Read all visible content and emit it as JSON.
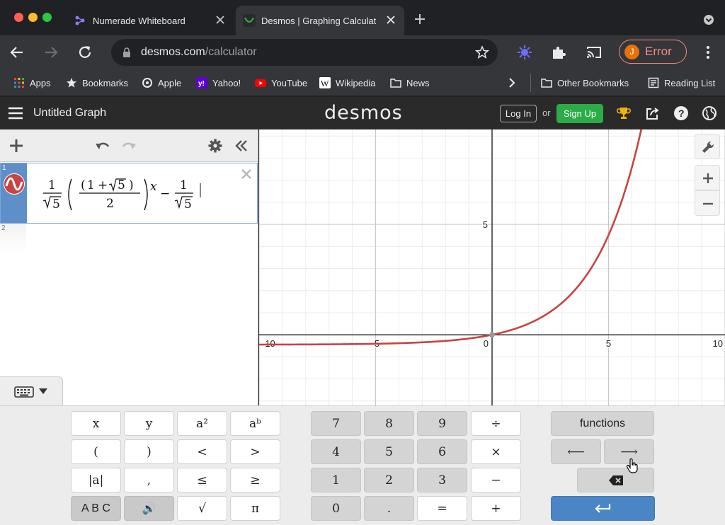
{
  "browser": {
    "tabs": [
      {
        "title": "Numerade Whiteboard",
        "active": false,
        "icon": "numerade-icon"
      },
      {
        "title": "Desmos | Graphing Calculator",
        "active": true,
        "icon": "desmos-favicon"
      }
    ],
    "url_host": "desmos.com",
    "url_path": "/calculator",
    "profile_initial": "J",
    "profile_status": "Error",
    "colors": {
      "error": "#f28b82",
      "avatar": "#e8710a"
    }
  },
  "bookmarks": {
    "items": [
      {
        "label": "Apps",
        "icon": "apps-grid-icon"
      },
      {
        "label": "Bookmarks",
        "icon": "star-icon"
      },
      {
        "label": "Apple",
        "icon": "apple-icon"
      },
      {
        "label": "Yahoo!",
        "icon": "yahoo-icon"
      },
      {
        "label": "YouTube",
        "icon": "youtube-icon"
      },
      {
        "label": "Wikipedia",
        "icon": "wikipedia-icon"
      },
      {
        "label": "News",
        "icon": "folder-icon"
      }
    ],
    "other": "Other Bookmarks",
    "reading_list": "Reading List"
  },
  "desmos": {
    "graph_title": "Untitled Graph",
    "logo": "desmos",
    "login": "Log In",
    "or": "or",
    "signup": "Sign Up",
    "signup_color": "#2bac47"
  },
  "expressions": {
    "list": [
      {
        "index": "1",
        "latex": "\\frac{1}{\\sqrt{5}}\\left(\\frac{\\left(1+\\sqrt{5}\\right)}{2}\\right)^{x}-\\frac{1}{\\sqrt{5}}",
        "color": "#c74440"
      },
      {
        "index": "2",
        "latex": ""
      }
    ],
    "math_parts": {
      "one": "1",
      "five": "5",
      "plus": "+",
      "two": "2",
      "x": "x",
      "minus": "−",
      "lparen": "(",
      "rparen": ")"
    }
  },
  "graph": {
    "x_range": [
      -10,
      10
    ],
    "y_range": [
      -3.2,
      9.3
    ],
    "x_ticks": [
      "-10",
      "-5",
      "0",
      "5",
      "10"
    ],
    "y_ticks": [
      "5"
    ],
    "grid": true,
    "curve_color": "#c74440"
  },
  "keypad": {
    "math_keys": [
      [
        "x",
        "y",
        "a²",
        "aᵇ"
      ],
      [
        "(",
        ")",
        "<",
        ">"
      ],
      [
        "|a|",
        ",",
        "≤",
        "≥"
      ],
      [
        "A B C",
        "🔊",
        "√",
        "π"
      ]
    ],
    "number_keys": [
      [
        "7",
        "8",
        "9",
        "÷"
      ],
      [
        "4",
        "5",
        "6",
        "×"
      ],
      [
        "1",
        "2",
        "3",
        "−"
      ],
      [
        "0",
        ".",
        "=",
        "+"
      ]
    ],
    "functions": "functions",
    "left_arrow": "⟵",
    "right_arrow": "⟶",
    "enter_color": "#4a86c5"
  }
}
